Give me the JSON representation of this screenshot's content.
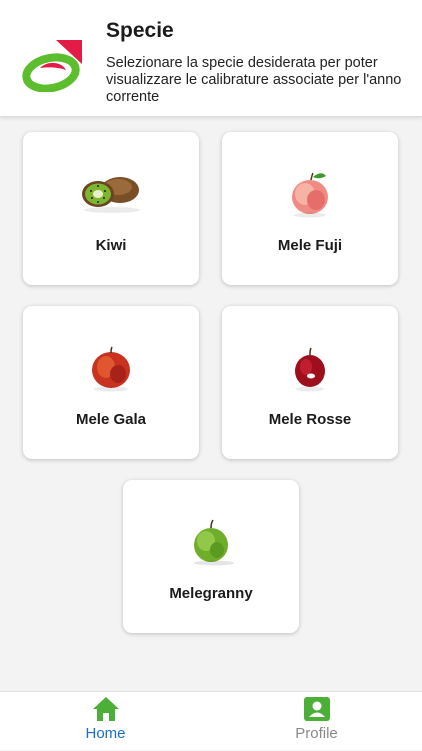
{
  "header": {
    "title": "Specie",
    "subtitle": "Selezionare la specie desiderata per poter visualizzare le calibrature associate per l'anno corrente"
  },
  "species": [
    {
      "label": "Kiwi",
      "icon": "kiwi-icon"
    },
    {
      "label": "Mele Fuji",
      "icon": "fuji-apple-icon"
    },
    {
      "label": "Mele Gala",
      "icon": "gala-apple-icon"
    },
    {
      "label": "Mele Rosse",
      "icon": "red-apple-icon"
    },
    {
      "label": "Melegranny",
      "icon": "green-apple-icon"
    }
  ],
  "tabbar": {
    "home_label": "Home",
    "profile_label": "Profile",
    "active_color": "#1a6fc9",
    "inactive_color": "#8a8a8a",
    "icon_color": "#4caf37"
  }
}
